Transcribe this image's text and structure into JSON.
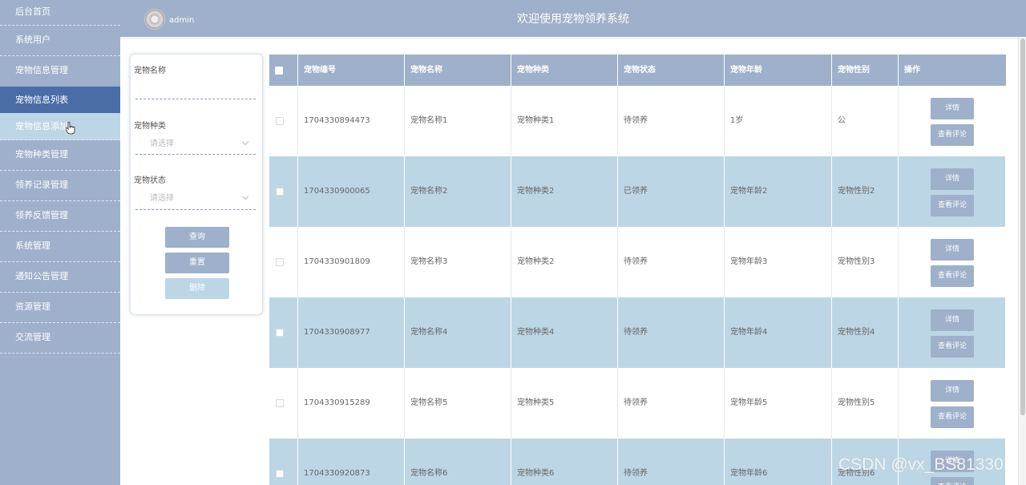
{
  "sidebar": {
    "items": [
      {
        "label": "后台首页"
      },
      {
        "label": "系统用户"
      },
      {
        "label": "宠物信息管理"
      },
      {
        "label": "宠物信息列表"
      },
      {
        "label": "宠物信息添加"
      },
      {
        "label": "宠物种类管理"
      },
      {
        "label": "领养记录管理"
      },
      {
        "label": "领养反馈管理"
      },
      {
        "label": "系统管理"
      },
      {
        "label": "通知公告管理"
      },
      {
        "label": "资源管理"
      },
      {
        "label": "交流管理"
      }
    ]
  },
  "header": {
    "username": "admin",
    "title": "欢迎使用宠物领养系统"
  },
  "search": {
    "name_label": "宠物名称",
    "name_value": "",
    "type_label": "宠物种类",
    "type_placeholder": "请选择",
    "status_label": "宠物状态",
    "status_placeholder": "请选择",
    "query_button": "查询",
    "reset_button": "重置",
    "delete_button": "删除"
  },
  "table": {
    "columns": [
      "宠物编号",
      "宠物名称",
      "宠物种类",
      "宠物状态",
      "宠物年龄",
      "宠物性别",
      "操作"
    ],
    "detail_label": "详情",
    "comment_label": "查看评论",
    "rows": [
      {
        "id": "1704330894473",
        "name": "宠物名称1",
        "type": "宠物种类1",
        "status": "待领养",
        "age": "1岁",
        "gender": "公"
      },
      {
        "id": "1704330900065",
        "name": "宠物名称2",
        "type": "宠物种类2",
        "status": "已领养",
        "age": "宠物年龄2",
        "gender": "宠物性别2"
      },
      {
        "id": "1704330901809",
        "name": "宠物名称3",
        "type": "宠物种类2",
        "status": "待领养",
        "age": "宠物年龄3",
        "gender": "宠物性别3"
      },
      {
        "id": "1704330908977",
        "name": "宠物名称4",
        "type": "宠物种类4",
        "status": "待领养",
        "age": "宠物年龄4",
        "gender": "宠物性别4"
      },
      {
        "id": "1704330915289",
        "name": "宠物名称5",
        "type": "宠物种类5",
        "status": "待领养",
        "age": "宠物年龄5",
        "gender": "宠物性别5"
      },
      {
        "id": "1704330920873",
        "name": "宠物名称6",
        "type": "宠物种类6",
        "status": "待领养",
        "age": "宠物年龄6",
        "gender": "宠物性别6"
      }
    ]
  },
  "watermark": "CSDN @vx_BS81330"
}
